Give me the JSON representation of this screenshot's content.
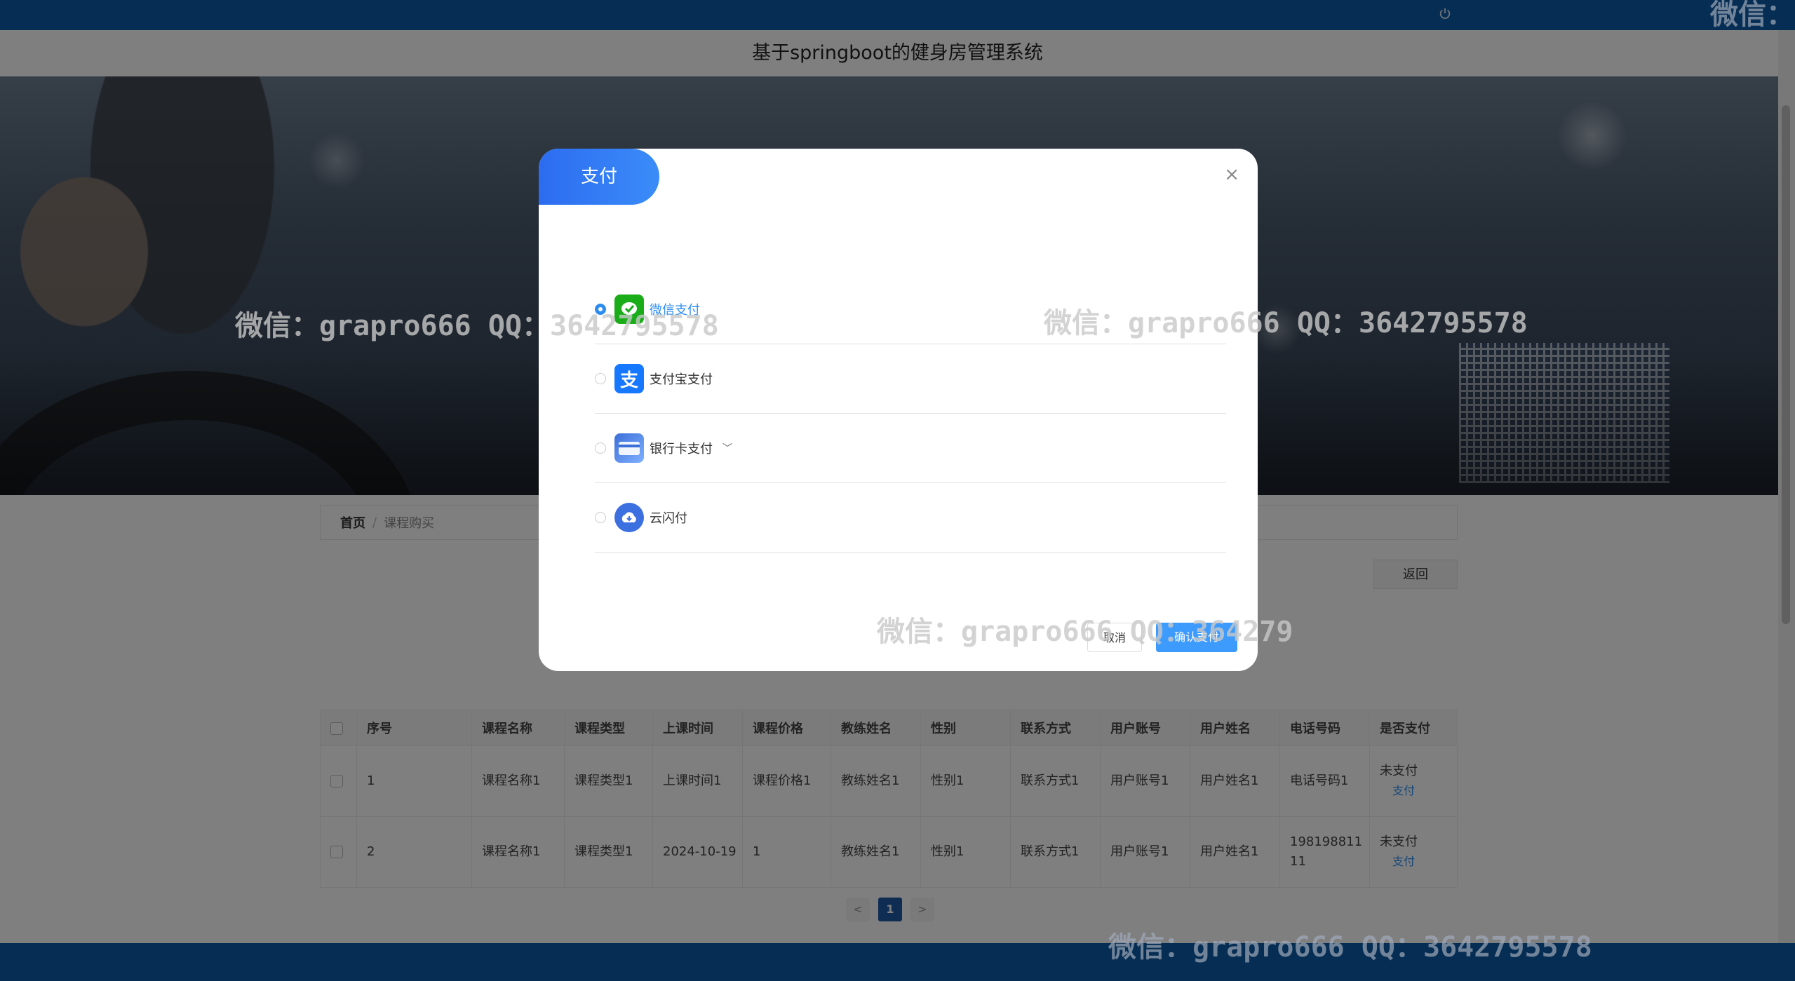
{
  "page": {
    "title": "基于springboot的健身房管理系统"
  },
  "breadcrumb": {
    "home": "首页",
    "separator": "/",
    "current": "课程购买"
  },
  "actions": {
    "back_label": "返回"
  },
  "table": {
    "headers": [
      "序号",
      "课程名称",
      "课程类型",
      "上课时间",
      "课程价格",
      "教练姓名",
      "性别",
      "联系方式",
      "用户账号",
      "用户姓名",
      "电话号码",
      "是否支付"
    ],
    "rows": [
      {
        "index": "1",
        "course_name": "课程名称1",
        "course_type": "课程类型1",
        "class_time": "上课时间1",
        "price": "课程价格1",
        "coach": "教练姓名1",
        "gender": "性别1",
        "contact": "联系方式1",
        "account": "用户账号1",
        "user_name": "用户姓名1",
        "phone": "电话号码1",
        "paid": "未支付",
        "pay_link": "支付"
      },
      {
        "index": "2",
        "course_name": "课程名称1",
        "course_type": "课程类型1",
        "class_time": "2024-10-19",
        "price": "1",
        "coach": "教练姓名1",
        "gender": "性别1",
        "contact": "联系方式1",
        "account": "用户账号1",
        "user_name": "用户姓名1",
        "phone": "19819881111",
        "paid": "未支付",
        "pay_link": "支付"
      }
    ]
  },
  "pagination": {
    "prev": "<",
    "current": "1",
    "next": ">"
  },
  "modal": {
    "title": "支付",
    "close": "×",
    "options": [
      {
        "label": "微信支付",
        "icon": "wechat-pay-icon",
        "color": "#1aad19",
        "selected": true
      },
      {
        "label": "支付宝支付",
        "icon": "alipay-icon",
        "color": "#1677ff",
        "selected": false
      },
      {
        "label": "银行卡支付",
        "icon": "bank-card-icon",
        "color": "#3b6fd8",
        "selected": false
      },
      {
        "label": "云闪付",
        "icon": "unionpay-cloud-icon",
        "color": "#3c6fe0",
        "selected": false
      }
    ],
    "cancel_label": "取消",
    "confirm_label": "确认支付"
  },
  "watermarks": {
    "w1": "微信：grapro666 QQ：3642795578",
    "w2": "微信：grapro666 QQ：3642795578",
    "w3": "微信：grapro666 QQ：364279",
    "w4": "微信：grapro666 QQ：3642795578",
    "w5": "微信："
  },
  "colors": {
    "header": "#0d5aa6",
    "accent": "#2d8cf0",
    "modal_tab": "#2c6cf0"
  }
}
